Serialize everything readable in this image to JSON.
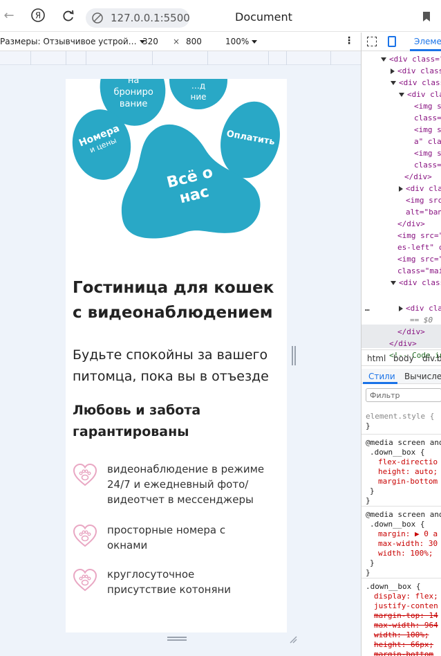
{
  "browser": {
    "url": "127.0.0.1:5500",
    "doc_title": "Document",
    "yandex_label": "Я"
  },
  "device_toolbar": {
    "preset": "Размеры: Отзывчивое устрой…",
    "width": "320",
    "times": "×",
    "height": "800",
    "zoom": "100%",
    "more": "⋮"
  },
  "site": {
    "nav": {
      "paw1": [
        "на",
        "брониро",
        "вание"
      ],
      "paw2": [
        "…д",
        "ние"
      ],
      "pay": "Оплатить",
      "rooms_title": "Номера",
      "rooms_sub": "и цены",
      "about": "Всё о нас"
    },
    "heading": "Гостиница для кошек с видеонаблюдением",
    "lead": "Будьте спокойны за вашего питомца, пока вы в отъезде",
    "subheading": "Любовь и забота гарантированы",
    "features": [
      {
        "icon": "heart-paw-icon",
        "text": "видеонаблюдение в режиме 24/7 и ежедневный фото/видеотчет в мессенджеры"
      },
      {
        "icon": "heart-paw-icon",
        "text": "просторные номера с окнами"
      },
      {
        "icon": "heart-paw-icon",
        "text": "круглосуточное присутствие котоняни"
      }
    ],
    "accent_color": "#29a8c6",
    "icon_color": "#e9a7c3"
  },
  "devtools": {
    "elements_tab": "Элеме",
    "dom_lines": [
      "<div class=\"",
      "<div class",
      "<div class",
      "<div cla",
      "<img s",
      "class=",
      "<img s",
      "a\" cla",
      "<img s",
      "class=",
      "</div>",
      "<div cla",
      "<img src",
      "alt=\"ban",
      "</div>",
      "<img src=\"",
      "es-left\" c",
      "<img src=\"",
      "class=\"mai",
      "<div class",
      "<div cla",
      "== $0",
      "</div>",
      "</div>",
      "<!-- Code in"
    ],
    "ellipsis": "…",
    "breadcrumbs": [
      "html",
      "body",
      "div.bo"
    ],
    "styles_tabs": [
      "Стили",
      "Вычислен"
    ],
    "filter_placeholder": "Фильтр",
    "css_lines": [
      "element.style {",
      "}",
      "@media screen and",
      ".down__box {",
      "flex-directio",
      "height: auto;",
      "margin-bottom",
      "}",
      "}",
      "@media screen and",
      ".down__box {",
      "margin: ▶ 0 a",
      "max-width: 30",
      "width: 100%;",
      "}",
      "}",
      ".down__box {",
      "display: flex;",
      "justify-conten",
      "margin-top: 14",
      "max-width: 964",
      "width: 100%;",
      "height: 66px;",
      "margin-bottom"
    ]
  }
}
